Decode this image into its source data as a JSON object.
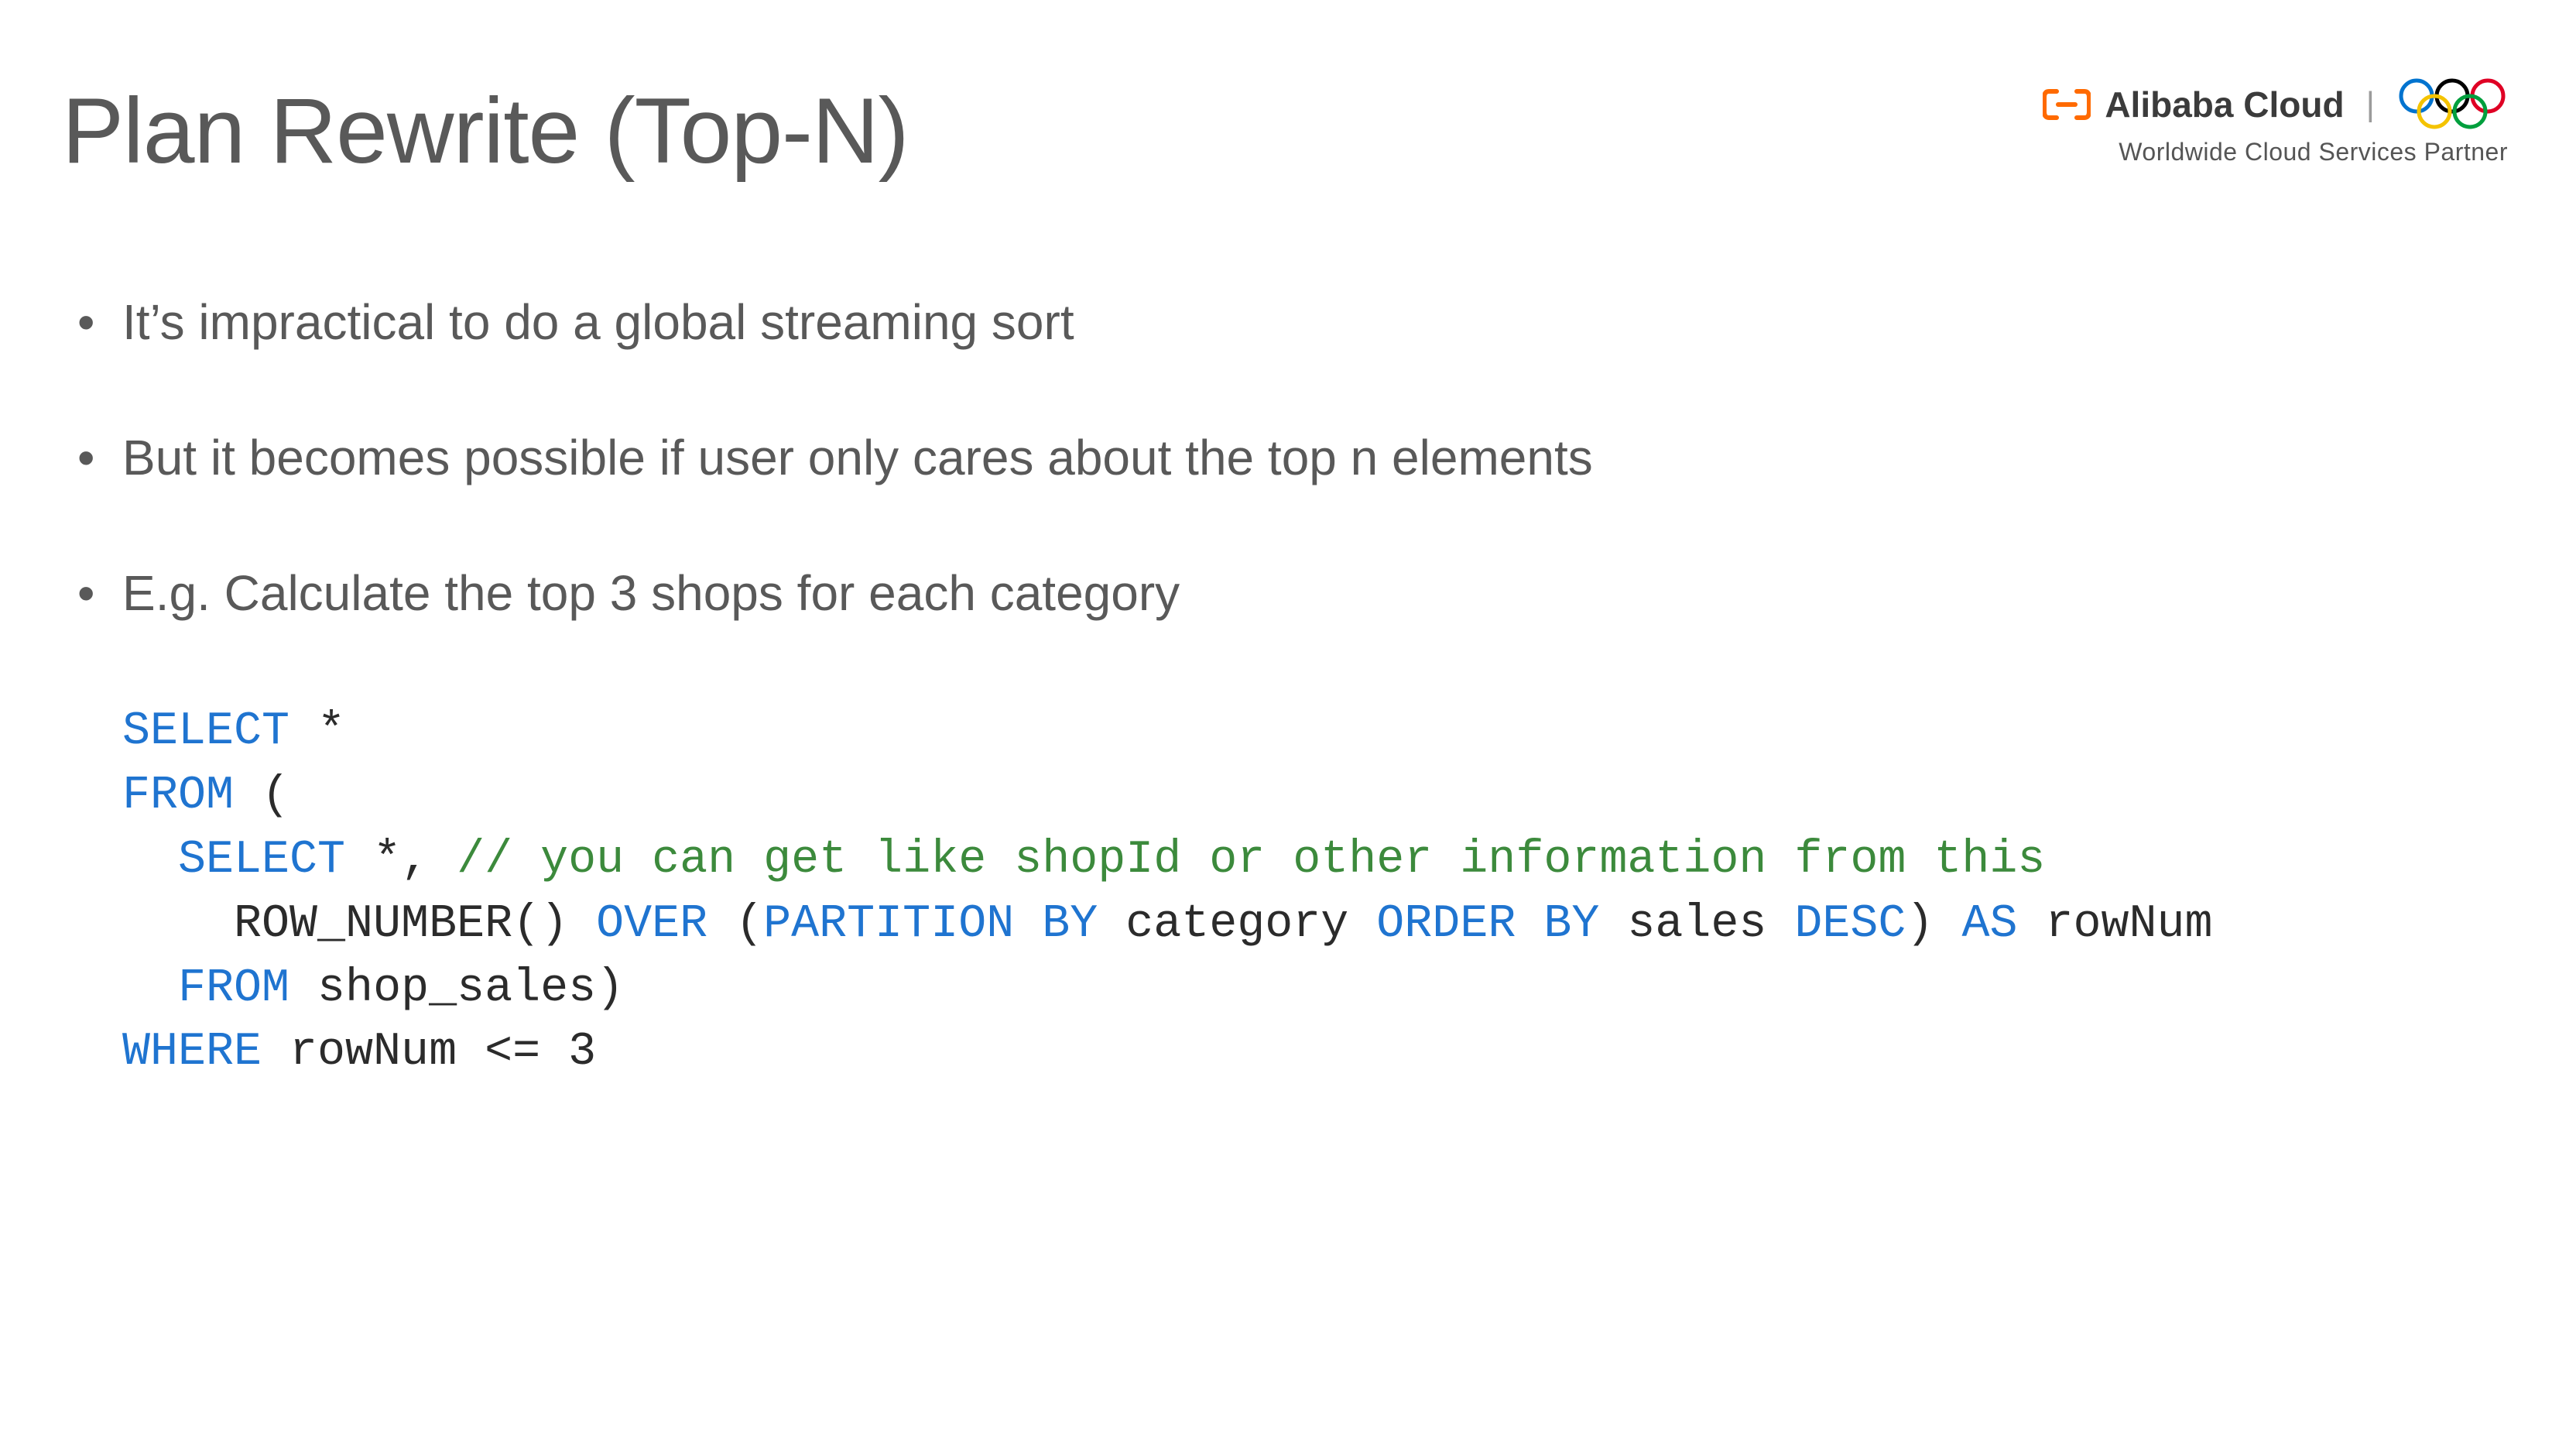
{
  "title": "Plan Rewrite (Top-N)",
  "brand": {
    "name": "Alibaba Cloud",
    "tagline": "Worldwide Cloud Services Partner"
  },
  "bullets": [
    "It’s impractical to do a global streaming sort",
    "But it becomes possible if user only cares about the top n elements",
    "E.g. Calculate the top 3 shops for each category"
  ],
  "code": {
    "l1_a": "SELECT",
    "l1_b": " *",
    "l2_a": "FROM",
    "l2_b": " (",
    "l3_a": "  ",
    "l3_b": "SELECT",
    "l3_c": " *, ",
    "l3_d": "// you can get like shopId or other information from this",
    "l4_a": "    ROW_NUMBER() ",
    "l4_b": "OVER",
    "l4_c": " (",
    "l4_d": "PARTITION BY",
    "l4_e": " category ",
    "l4_f": "ORDER BY",
    "l4_g": " sales ",
    "l4_h": "DESC",
    "l4_i": ") ",
    "l4_j": "AS",
    "l4_k": " rowNum",
    "l5_a": "  ",
    "l5_b": "FROM",
    "l5_c": " shop_sales)",
    "l6_a": "WHERE",
    "l6_b": " rowNum <= 3"
  }
}
